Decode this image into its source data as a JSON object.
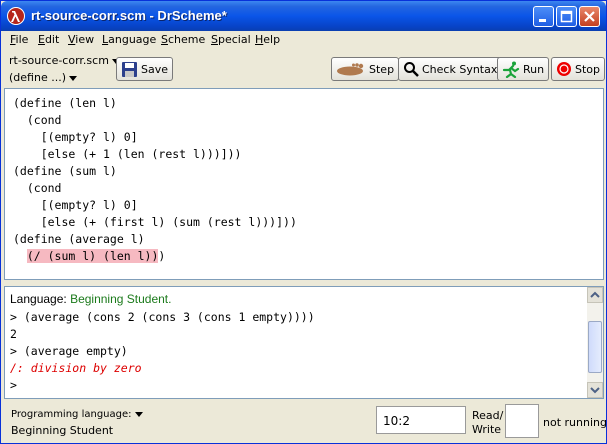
{
  "window": {
    "title": "rt-source-corr.scm - DrScheme*"
  },
  "menu": [
    "File",
    "Edit",
    "View",
    "Language",
    "Scheme",
    "Special",
    "Help"
  ],
  "toolbar": {
    "filename": "rt-source-corr.scm",
    "define_menu": "(define ...)",
    "save": "Save",
    "step": "Step",
    "check_syntax": "Check Syntax",
    "run": "Run",
    "stop": "Stop"
  },
  "definitions": [
    "(define (len l)",
    "  (cond",
    "    [(empty? l) 0]",
    "    [else (+ 1 (len (rest l)))]))",
    "(define (sum l)",
    "  (cond",
    "    [(empty? l) 0]",
    "    [else (+ (first l) (sum (rest l)))]))",
    "(define (average l)",
    "  (/ (sum l) (len l)))"
  ],
  "definitions_highlight": "(/ (sum l) (len l))",
  "interactions": {
    "language_label": "Language: ",
    "language_name": "Beginning Student.",
    "lines": [
      "> (average (cons 2 (cons 3 (cons 1 empty))))",
      "2",
      "> (average empty)"
    ],
    "error": "/: division by zero",
    "prompt": ">"
  },
  "status": {
    "programming_language_label": "Programming language:",
    "language_value": "Beginning Student",
    "position": "10:2",
    "rw_line1": "Read/",
    "rw_line2": "Write",
    "state": "not running"
  },
  "colors": {
    "title_bar": "#0a55e8",
    "highlight": "#f6b9c1",
    "language_name": "#1b7a1b",
    "error": "#dd0000"
  }
}
